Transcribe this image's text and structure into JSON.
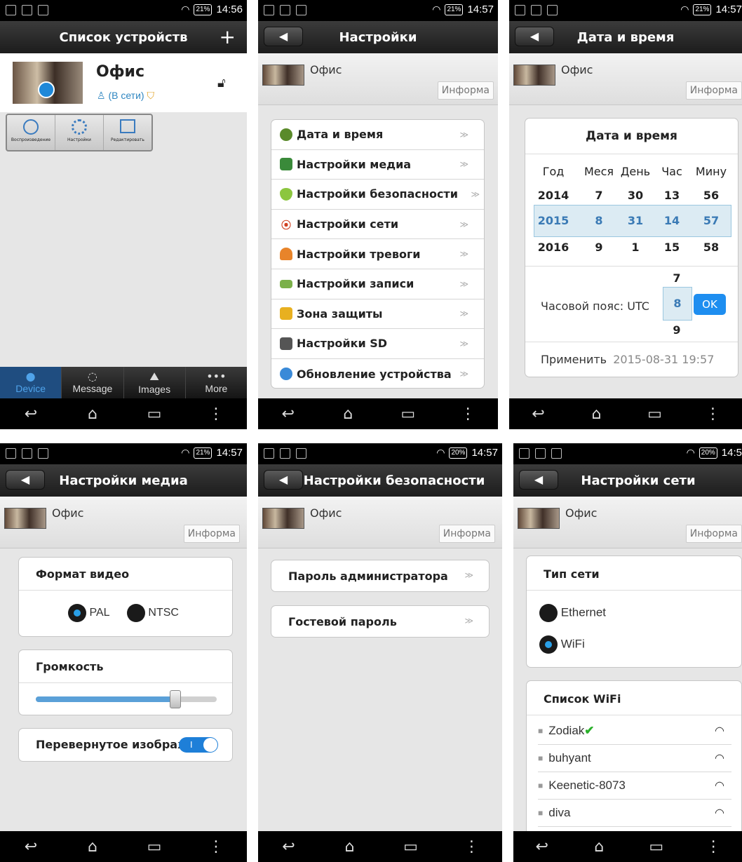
{
  "status": {
    "p1": {
      "time": "14:56",
      "battery": "21%"
    },
    "p2": {
      "time": "14:57",
      "battery": "21%"
    },
    "p3": {
      "time": "14:57",
      "battery": "21%"
    },
    "p4": {
      "time": "14:57",
      "battery": "21%"
    },
    "p5": {
      "time": "14:57",
      "battery": "20%"
    },
    "p6": {
      "time": "14:5",
      "battery": "20%"
    }
  },
  "device_name": "Офис",
  "info_button": "Информа",
  "p1": {
    "title": "Список устройств",
    "add": "+",
    "device_name": "Офис",
    "online": "(В сети)",
    "toolbar": [
      "Воспроизведение",
      "Настройки",
      "Редактировать"
    ],
    "tabs": [
      "Device",
      "Message",
      "Images",
      "More"
    ]
  },
  "p2": {
    "title": "Настройки",
    "items": [
      "Дата и время",
      "Настройки медиа",
      "Настройки безопасности",
      "Настройки сети",
      "Настройки тревоги",
      "Настройки записи",
      "Зона защиты",
      "Настройки SD",
      "Обновление устройства"
    ]
  },
  "p3": {
    "title": "Дата и время",
    "card_title": "Дата и время",
    "headers": [
      "Год",
      "Меся",
      "День",
      "Час",
      "Мину"
    ],
    "row_top": [
      "2014",
      "7",
      "30",
      "13",
      "56"
    ],
    "row_sel": [
      "2015",
      "8",
      "31",
      "14",
      "57"
    ],
    "row_bot": [
      "2016",
      "9",
      "1",
      "15",
      "58"
    ],
    "tz_label": "Часовой пояс: UTC",
    "tz_top": "7",
    "tz_sel": "8",
    "tz_bot": "9",
    "ok": "OK",
    "apply_label": "Применить",
    "apply_value": "2015-08-31 19:57"
  },
  "p4": {
    "title": "Настройки медиа",
    "video_format": "Формат видео",
    "pal": "PAL",
    "ntsc": "NTSC",
    "volume": "Громкость",
    "volume_level": 0.77,
    "flip": "Перевернутое изображ",
    "flip_state": "I"
  },
  "p5": {
    "title": "Настройки безопасности",
    "admin": "Пароль администратора",
    "guest": "Гостевой пароль"
  },
  "p6": {
    "title": "Настройки сети",
    "net_type": "Тип сети",
    "ethernet": "Ethernet",
    "wifi": "WiFi",
    "wifi_list": "Список WiFi",
    "networks": [
      "Zodiak",
      "buhyant",
      "Keenetic-8073",
      "diva"
    ],
    "connected_mark": "✔"
  },
  "chevron": "≫"
}
